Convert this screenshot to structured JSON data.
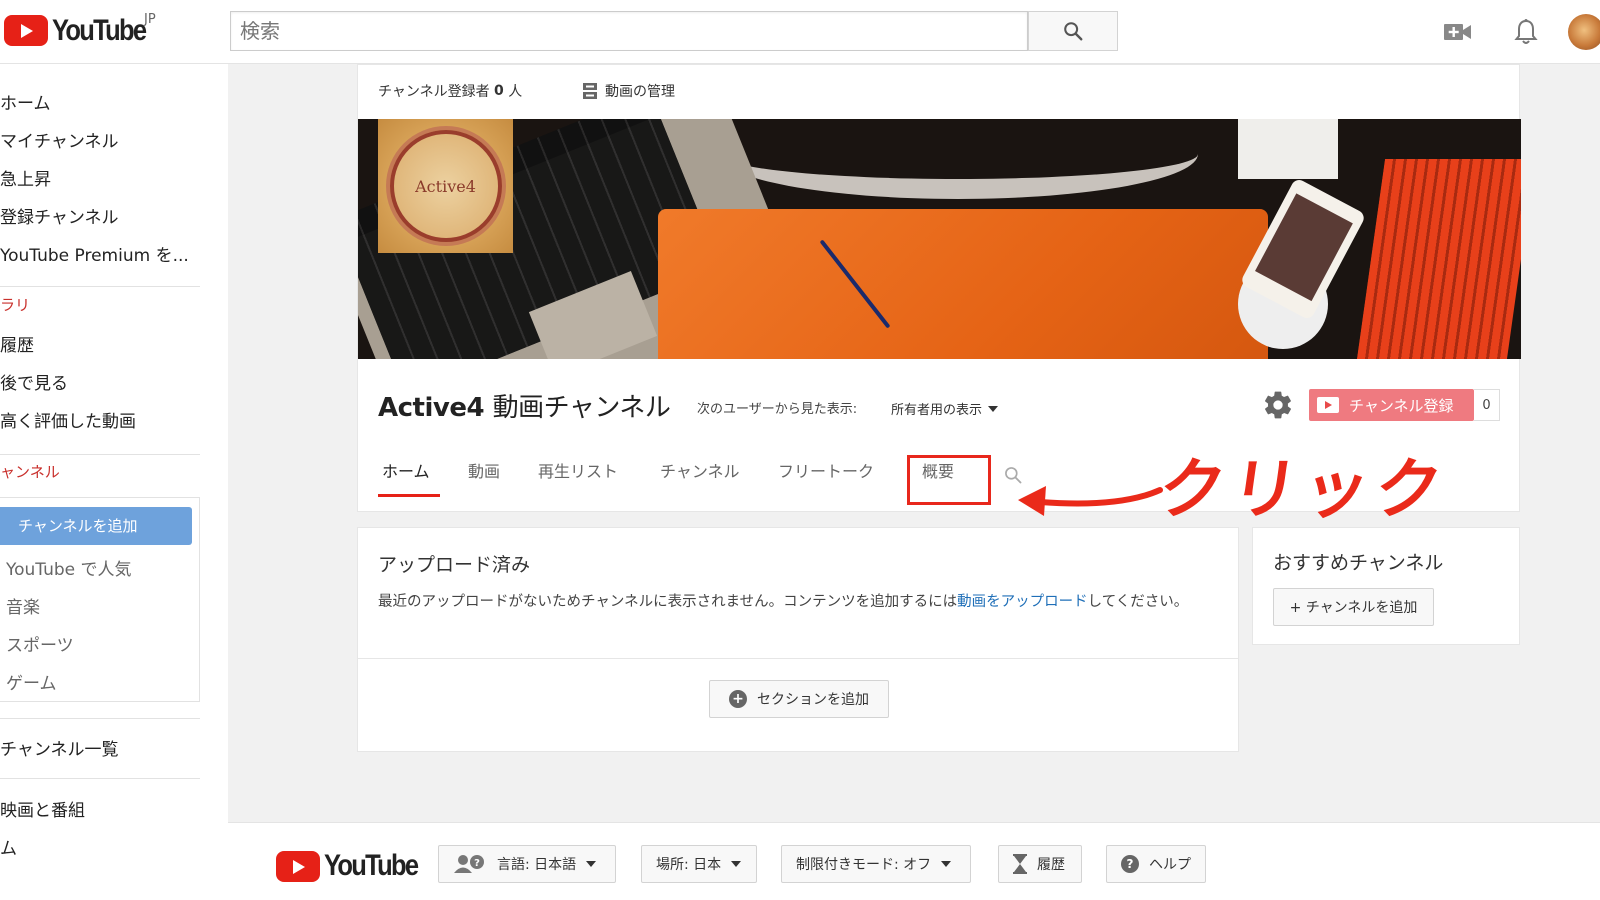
{
  "header": {
    "logo_text": "YouTube",
    "logo_region": "JP",
    "search_placeholder": "検索",
    "icons": [
      "search-icon",
      "upload-video-icon",
      "notifications-bell-icon",
      "account-avatar"
    ]
  },
  "sidebar": {
    "main_items": [
      {
        "label": "ホーム"
      },
      {
        "label": "マイチャンネル"
      },
      {
        "label": "急上昇"
      },
      {
        "label": "登録チャンネル"
      },
      {
        "label": "YouTube Premium を..."
      }
    ],
    "library_heading": "ラリ",
    "library_items": [
      {
        "label": "履歴"
      },
      {
        "label": "後で見る"
      },
      {
        "label": "高く評価した動画"
      }
    ],
    "channels_heading": "ャンネル",
    "channel_suggestions": [
      {
        "label": "チャンネルを追加",
        "selected": true
      },
      {
        "label": "YouTube で人気"
      },
      {
        "label": "音楽"
      },
      {
        "label": "スポーツ"
      },
      {
        "label": "ゲーム"
      }
    ],
    "browse_channels": "チャンネル一覧",
    "more_items": [
      {
        "label": "映画と番組"
      },
      {
        "label": "ム"
      }
    ]
  },
  "channel": {
    "subscribers_label": "チャンネル登録者",
    "subscribers_count": "0",
    "subscribers_unit": "人",
    "manage_videos": "動画の管理",
    "logo_text": "Active4",
    "title_latin": "Active4",
    "title_jp": "動画チャンネル",
    "view_as_label": "次のユーザーから見た表示:",
    "view_as_value": "所有者用の表示",
    "subscribe_label": "チャンネル登録",
    "subscribe_count": "0",
    "tabs": [
      {
        "label": "ホーム",
        "active": true
      },
      {
        "label": "動画"
      },
      {
        "label": "再生リスト"
      },
      {
        "label": "チャンネル"
      },
      {
        "label": "フリートーク"
      },
      {
        "label": "概要",
        "highlighted": true
      }
    ]
  },
  "annotation": {
    "text": "クリック",
    "color": "#ea2a1a"
  },
  "uploads": {
    "title": "アップロード済み",
    "desc_before": "最近のアップロードがないためチャンネルに表示されません。コンテンツを追加するには",
    "desc_link": "動画をアップロード",
    "desc_after": "してください。",
    "add_section": "セクションを追加"
  },
  "recommended": {
    "title": "おすすめチャンネル",
    "add_button": "+ チャンネルを追加"
  },
  "footer": {
    "logo_text": "YouTube",
    "language": "言語: 日本語",
    "location": "場所: 日本",
    "restricted_mode": "制限付きモード: オフ",
    "history": "履歴",
    "help": "ヘルプ"
  },
  "colors": {
    "brand_red": "#e62117",
    "link_blue": "#1f6fb8",
    "subscribe_pink": "#ef7a80",
    "sidebar_selected": "#6ea2dc"
  }
}
